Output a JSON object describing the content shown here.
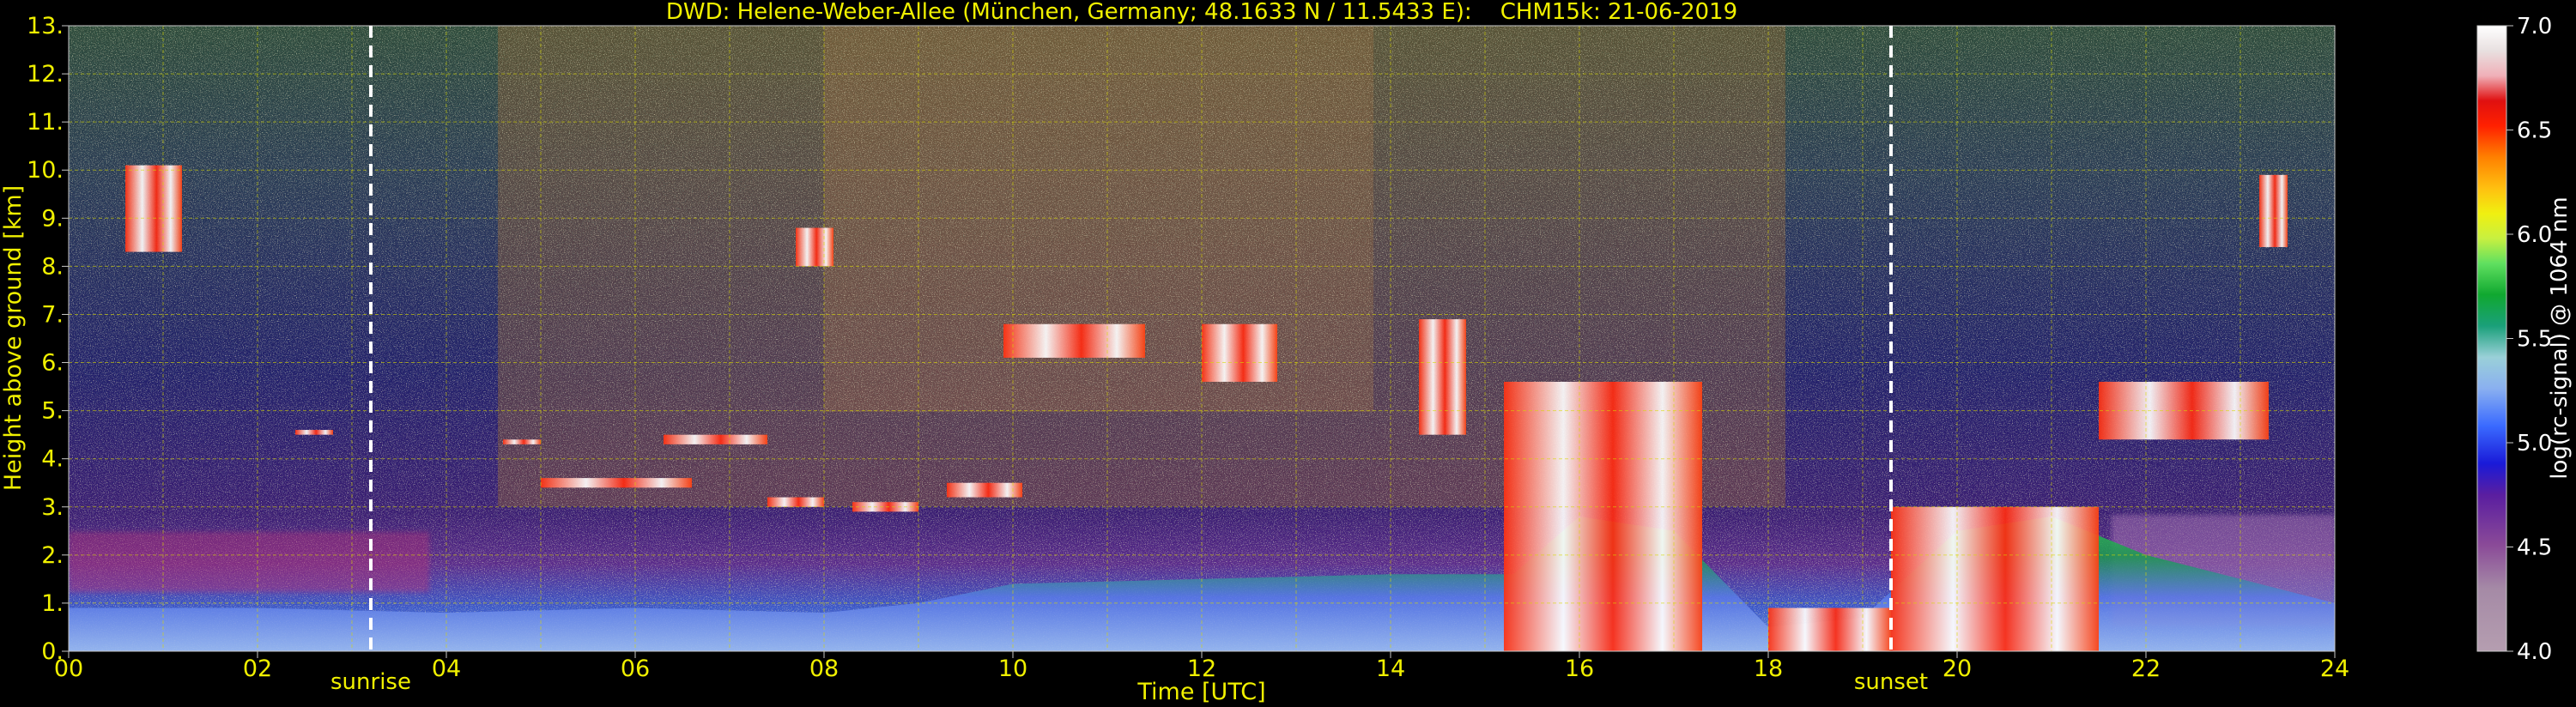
{
  "chart_data": {
    "type": "heatmap",
    "title": "DWD: Helene-Weber-Allee (München, Germany; 48.1633 N / 11.5433 E):    CHM15k: 21-06-2019",
    "xlabel": "Time [UTC]",
    "ylabel": "Height above ground [km]",
    "xlim": [
      0,
      24
    ],
    "ylim": [
      0,
      13
    ],
    "x_ticks": [
      "00",
      "02",
      "04",
      "06",
      "08",
      "10",
      "12",
      "14",
      "16",
      "18",
      "20",
      "22",
      "24"
    ],
    "y_ticks": [
      "0.",
      "1.",
      "2.",
      "3.",
      "4.",
      "5.",
      "6.",
      "7.",
      "8.",
      "9.",
      "10.",
      "11.",
      "12.",
      "13."
    ],
    "grid": true,
    "colorbar": {
      "label": "log(rc-signal) @ 1064 nm",
      "range": [
        4.0,
        7.0
      ],
      "ticks": [
        "4.0",
        "4.5",
        "5.0",
        "5.5",
        "6.0",
        "6.5",
        "7.0"
      ]
    },
    "markers": [
      {
        "label": "sunrise",
        "time": 3.2
      },
      {
        "label": "sunset",
        "time": 19.3
      }
    ],
    "features": {
      "boundary_layer_height_km": [
        [
          0.0,
          0.9
        ],
        [
          2.0,
          0.9
        ],
        [
          4.0,
          0.8
        ],
        [
          6.0,
          0.9
        ],
        [
          8.0,
          0.8
        ],
        [
          9.0,
          1.0
        ],
        [
          10.0,
          1.4
        ],
        [
          12.0,
          1.5
        ],
        [
          14.0,
          1.6
        ],
        [
          15.3,
          1.6
        ],
        [
          16.0,
          2.8
        ],
        [
          17.0,
          2.5
        ],
        [
          18.0,
          0.5
        ],
        [
          19.0,
          0.7
        ],
        [
          20.0,
          2.5
        ],
        [
          21.0,
          2.8
        ],
        [
          22.0,
          2.0
        ],
        [
          24.0,
          1.0
        ]
      ],
      "cloud_layers": [
        {
          "t_start": 0.6,
          "t_end": 1.2,
          "base_km": 8.3,
          "top_km": 10.1
        },
        {
          "t_start": 2.4,
          "t_end": 2.8,
          "base_km": 4.5,
          "top_km": 4.6
        },
        {
          "t_start": 4.6,
          "t_end": 5.0,
          "base_km": 4.3,
          "top_km": 4.4
        },
        {
          "t_start": 5.0,
          "t_end": 6.6,
          "base_km": 3.4,
          "top_km": 3.6
        },
        {
          "t_start": 6.3,
          "t_end": 7.4,
          "base_km": 4.3,
          "top_km": 4.5
        },
        {
          "t_start": 7.4,
          "t_end": 8.0,
          "base_km": 3.0,
          "top_km": 3.2
        },
        {
          "t_start": 7.7,
          "t_end": 8.1,
          "base_km": 8.0,
          "top_km": 8.8
        },
        {
          "t_start": 8.3,
          "t_end": 9.0,
          "base_km": 2.9,
          "top_km": 3.1
        },
        {
          "t_start": 9.3,
          "t_end": 10.1,
          "base_km": 3.2,
          "top_km": 3.5
        },
        {
          "t_start": 9.9,
          "t_end": 11.4,
          "base_km": 6.1,
          "top_km": 6.8
        },
        {
          "t_start": 12.0,
          "t_end": 12.8,
          "base_km": 5.6,
          "top_km": 6.8
        },
        {
          "t_start": 14.3,
          "t_end": 14.8,
          "base_km": 4.5,
          "top_km": 6.9
        },
        {
          "t_start": 15.2,
          "t_end": 17.3,
          "base_km": 0.0,
          "top_km": 5.6
        },
        {
          "t_start": 18.0,
          "t_end": 19.3,
          "base_km": 0.0,
          "top_km": 0.9
        },
        {
          "t_start": 19.3,
          "t_end": 21.5,
          "base_km": 0.0,
          "top_km": 3.0
        },
        {
          "t_start": 21.5,
          "t_end": 23.3,
          "base_km": 4.4,
          "top_km": 5.6
        },
        {
          "t_start": 23.2,
          "t_end": 23.5,
          "base_km": 8.4,
          "top_km": 9.9
        }
      ]
    }
  }
}
